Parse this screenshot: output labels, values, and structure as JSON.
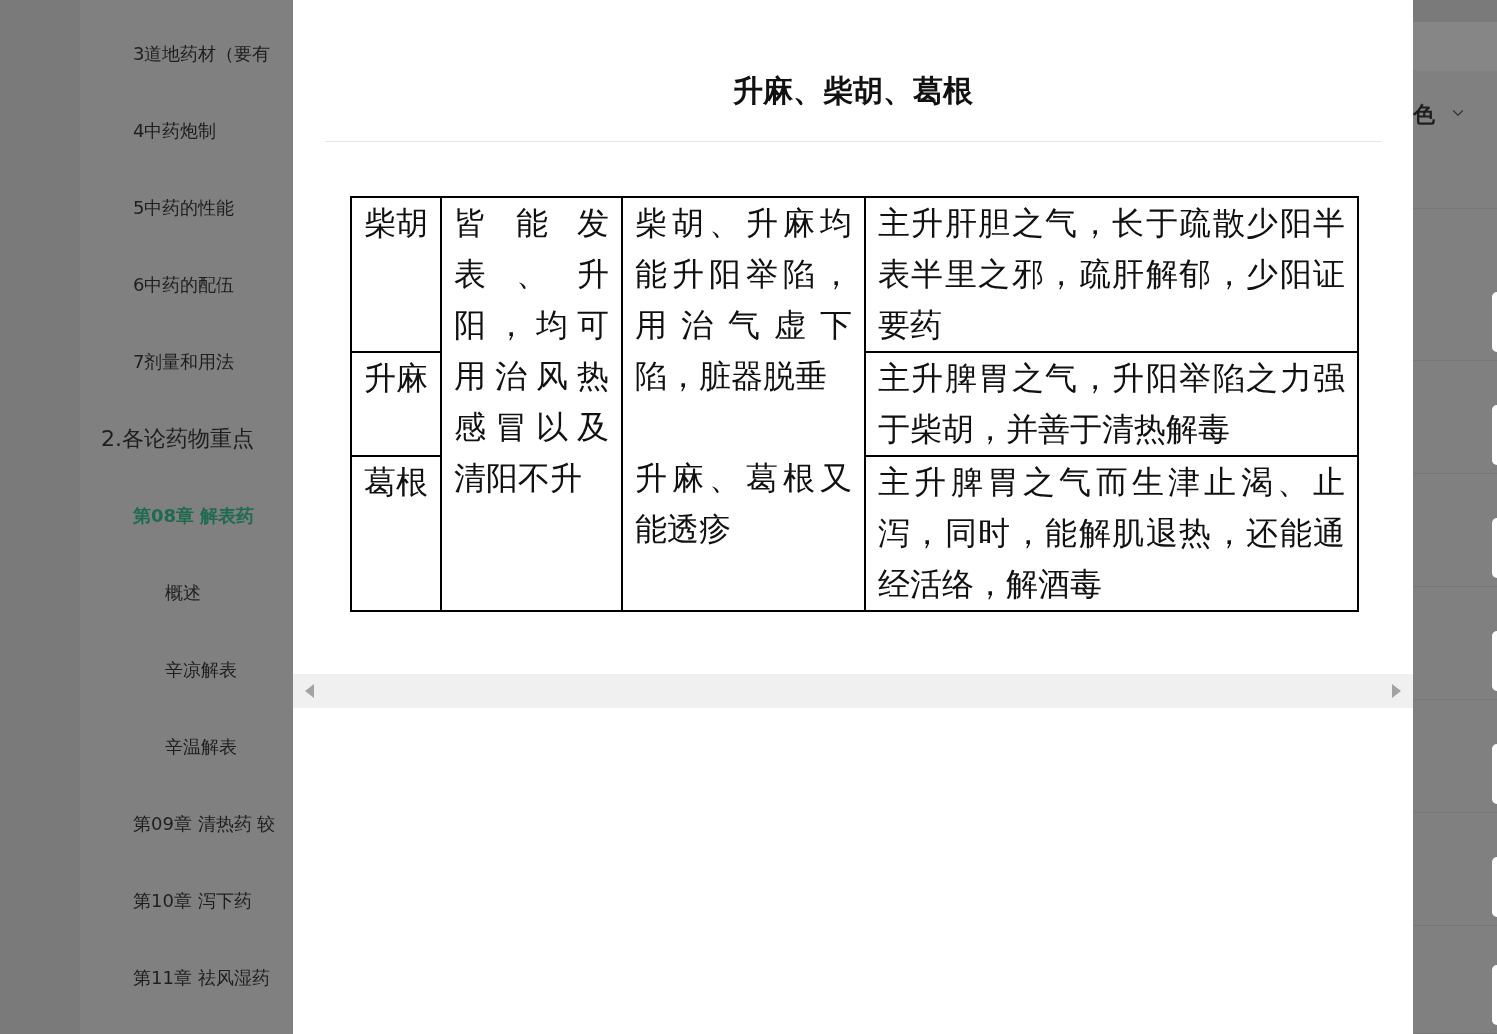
{
  "sidebar": {
    "groups": [
      {
        "items": [
          {
            "label": "3道地药材（要有",
            "selected": false
          },
          {
            "label": "4中药炮制",
            "selected": false
          },
          {
            "label": "5中药的性能",
            "selected": false
          },
          {
            "label": "6中药的配伍",
            "selected": false
          },
          {
            "label": "7剂量和用法",
            "selected": false
          }
        ]
      },
      {
        "title": "2.各论药物重点",
        "items": [
          {
            "label": "第08章 解表药",
            "selected": true,
            "children": [
              {
                "label": "概述",
                "selected": false
              },
              {
                "label": "辛凉解表",
                "selected": false
              },
              {
                "label": "辛温解表",
                "selected": false
              }
            ]
          },
          {
            "label": "第09章 清热药 较",
            "selected": false
          },
          {
            "label": "第10章 泻下药",
            "selected": false
          },
          {
            "label": "第11章 祛风湿药",
            "selected": false
          }
        ]
      }
    ]
  },
  "background_toolbar": {
    "dropdown_label": "色"
  },
  "dialog": {
    "title": "升麻、柴胡、葛根",
    "table": {
      "rows": [
        {
          "cells": [
            {
              "paragraphs": [
                "柴胡"
              ]
            },
            {
              "paragraphs": [
                "皆能发表、升阳，均可用治风热感冒以及清阳不升"
              ],
              "rowspan": 3
            },
            {
              "paragraphs": [
                "柴胡、升麻均能升阳举陷，用治气虚下陷，脏器脱垂",
                "升麻、葛根又能透疹"
              ],
              "rowspan": 3
            },
            {
              "paragraphs": [
                "主升肝胆之气，长于疏散少阳半表半里之邪，疏肝解郁，少阳证要药"
              ]
            }
          ]
        },
        {
          "cells": [
            {
              "paragraphs": [
                "升麻"
              ]
            },
            {
              "paragraphs": [
                "主升脾胃之气，升阳举陷之力强于柴胡，并善于清热解毒"
              ]
            }
          ]
        },
        {
          "cells": [
            {
              "paragraphs": [
                "葛根"
              ]
            },
            {
              "paragraphs": [
                "主升脾胃之气而生津止渴、止泻，同时，能解肌退热，还能通经活络，解酒毒"
              ]
            }
          ]
        }
      ]
    }
  }
}
